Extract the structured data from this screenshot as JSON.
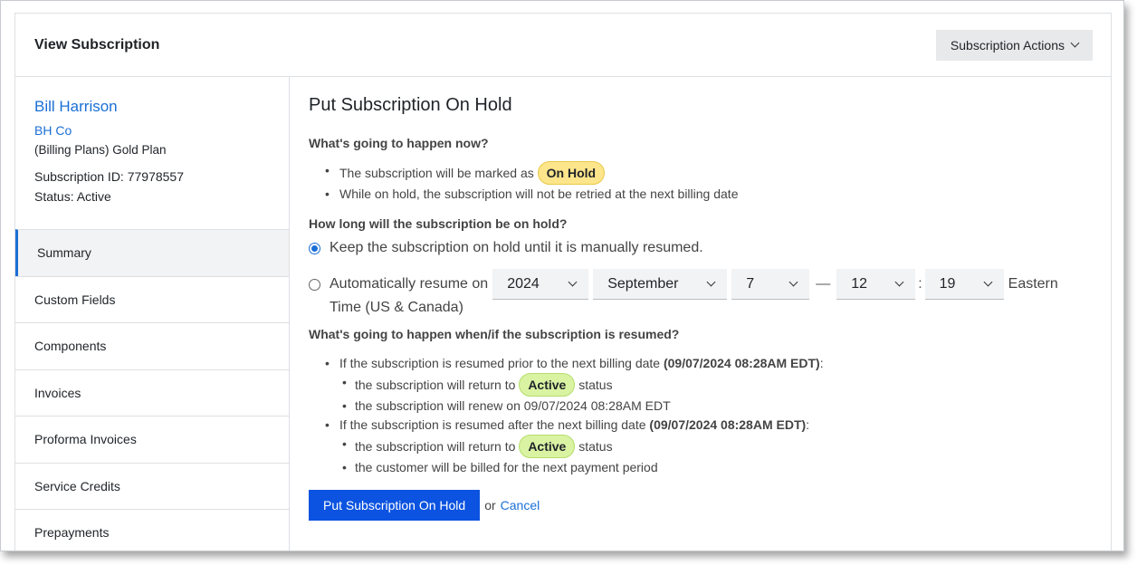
{
  "header": {
    "title": "View Subscription",
    "actions_label": "Subscription Actions"
  },
  "customer": {
    "name": "Bill Harrison",
    "company": "BH Co",
    "plan": "(Billing Plans) Gold Plan",
    "subscription_id": "Subscription ID: 77978557",
    "status": "Status: Active"
  },
  "sidebar": {
    "items": [
      {
        "label": "Summary"
      },
      {
        "label": "Custom Fields"
      },
      {
        "label": "Components"
      },
      {
        "label": "Invoices"
      },
      {
        "label": "Proforma Invoices"
      },
      {
        "label": "Service Credits"
      },
      {
        "label": "Prepayments"
      }
    ]
  },
  "main": {
    "title": "Put Subscription On Hold",
    "q1": "What's going to happen now?",
    "now_1_prefix": "The subscription will be marked as",
    "on_hold_badge": "On Hold",
    "now_2": "While on hold, the subscription will not be retried at the next billing date",
    "q2": "How long will the subscription be on hold?",
    "option_manual": "Keep the subscription on hold until it is manually resumed.",
    "option_auto_prefix": "Automatically resume on",
    "year": "2024",
    "month": "September",
    "day": "7",
    "dash": "—",
    "hour": "12",
    "colon": ":",
    "minute": "19",
    "tz_part1": "Eastern",
    "tz_part2": "Time (US & Canada)",
    "q3": "What's going to happen when/if the subscription is resumed?",
    "prior_prefix": "If the subscription is resumed prior to the next billing date",
    "prior_date": "(09/07/2024 08:28AM EDT)",
    "colon_after": ":",
    "return_prefix": "the subscription will return to",
    "active_badge": "Active",
    "return_suffix": "status",
    "renew_text": "the subscription will renew on 09/07/2024 08:28AM EDT",
    "after_prefix": "If the subscription is resumed after the next billing date",
    "after_date": "(09/07/2024 08:28AM EDT)",
    "billed_text": "the customer will be billed for the next payment period",
    "submit_label": "Put Subscription On Hold",
    "or_text": "or",
    "cancel_label": "Cancel"
  },
  "colors": {
    "primary": "#0b53e0",
    "link": "#1a6fd6",
    "on_hold": "#fde58b",
    "active": "#d9f3a3"
  },
  "icons": {
    "dropdown": "chevron-down-icon"
  }
}
